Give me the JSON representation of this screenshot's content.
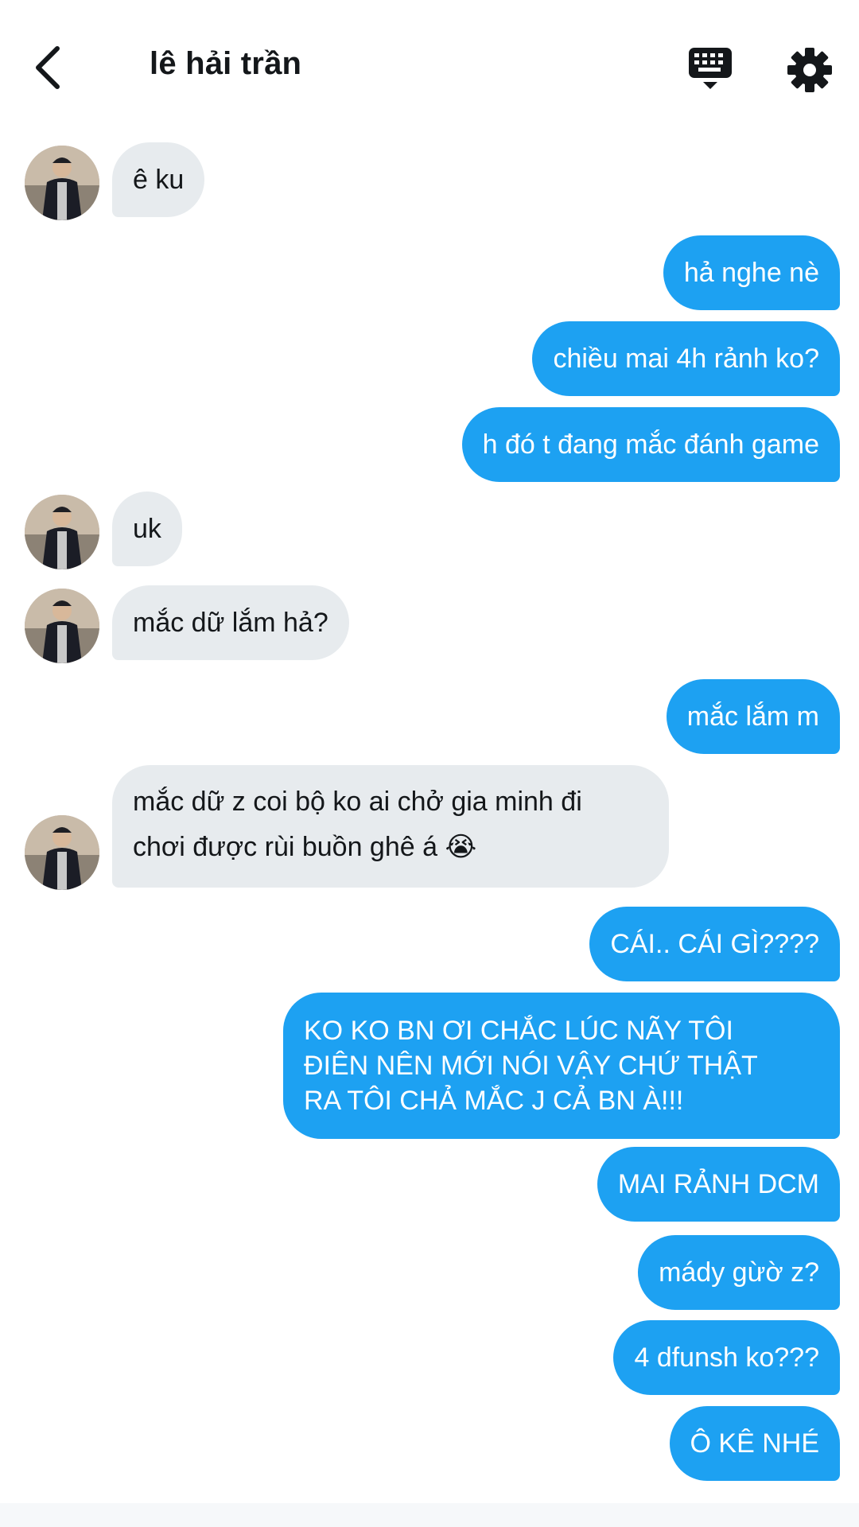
{
  "header": {
    "title": "lê hải trần",
    "back_icon": "chevron-left-icon",
    "keyboard_icon": "keyboard-icon",
    "settings_icon": "gear-icon"
  },
  "colors": {
    "outgoing_bubble": "#1da1f2",
    "incoming_bubble": "#e7ebee",
    "text_dark": "#14171a"
  },
  "messages": [
    {
      "direction": "incoming",
      "text": "ê ku"
    },
    {
      "direction": "outgoing",
      "text": "hả nghe nè"
    },
    {
      "direction": "outgoing",
      "text": "chiều mai 4h rảnh ko?"
    },
    {
      "direction": "outgoing",
      "text": "h đó t đang mắc đánh game"
    },
    {
      "direction": "incoming",
      "text": "uk"
    },
    {
      "direction": "incoming",
      "text": "mắc dữ lắm hả?"
    },
    {
      "direction": "outgoing",
      "text": "mắc lắm m"
    },
    {
      "direction": "incoming",
      "lines": [
        "mắc dữ z coi bộ ko ai chở gia minh đi",
        "chơi được rùi buồn ghê á 😭"
      ]
    },
    {
      "direction": "outgoing",
      "text": "CÁI.. CÁI GÌ????"
    },
    {
      "direction": "outgoing",
      "lines": [
        "KO KO BN ƠI CHẮC LÚC NÃY TÔI",
        "ĐIÊN NÊN MỚI NÓI VẬY CHỨ THẬT",
        "RA TÔI CHẢ MẮC J CẢ BN À!!!"
      ]
    },
    {
      "direction": "outgoing",
      "text": "MAI RẢNH DCM"
    },
    {
      "direction": "outgoing",
      "text": "mády gừờ z?"
    },
    {
      "direction": "outgoing",
      "text": "4 dfunsh ko???"
    },
    {
      "direction": "outgoing",
      "text": "Ô KÊ NHÉ"
    }
  ]
}
